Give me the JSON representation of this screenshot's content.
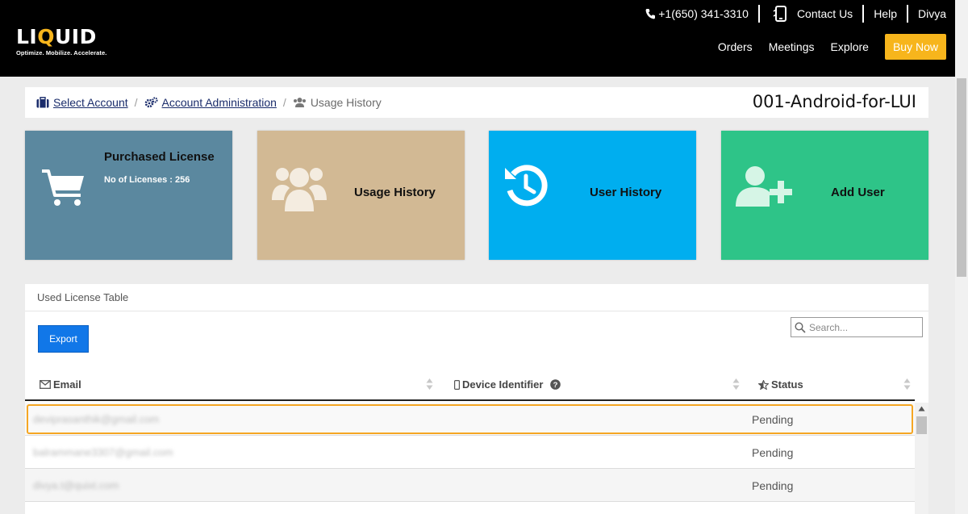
{
  "header": {
    "logo_text_pre": "LI",
    "logo_text_q": "Q",
    "logo_text_post": "UID",
    "logo_tagline": "Optimize. Mobilize. Accelerate.",
    "phone": "+1(650) 341-3310",
    "contact": "Contact Us",
    "help": "Help",
    "user": "Divya",
    "nav": [
      "Orders",
      "Meetings",
      "Explore"
    ],
    "buy_now": "Buy Now",
    "brand_color": "#f7b51c"
  },
  "breadcrumb": {
    "items": [
      "Select Account",
      "Account Administration"
    ],
    "current": "Usage History",
    "account_name": "001-Android-for-LUI"
  },
  "tiles": [
    {
      "title": "Purchased License",
      "subtitle": "No of Licenses : 256",
      "icon": "cart-icon",
      "color": "#5b889f"
    },
    {
      "title": "Usage History",
      "icon": "users-icon",
      "color": "#d2b994"
    },
    {
      "title": "User History",
      "icon": "history-icon",
      "color": "#00aeef"
    },
    {
      "title": "Add User",
      "icon": "add-user-icon",
      "color": "#2ec488"
    }
  ],
  "table": {
    "title": "Used License Table",
    "export_label": "Export",
    "search_placeholder": "Search...",
    "columns": [
      "Email",
      "Device Identifier",
      "Status"
    ],
    "rows": [
      {
        "email": "deviprasanthik@gmail.com",
        "status": "Pending"
      },
      {
        "email": "balrammane3307@gmail.com",
        "status": "Pending"
      },
      {
        "email": "divya.t@quixt.com",
        "status": "Pending"
      }
    ]
  }
}
